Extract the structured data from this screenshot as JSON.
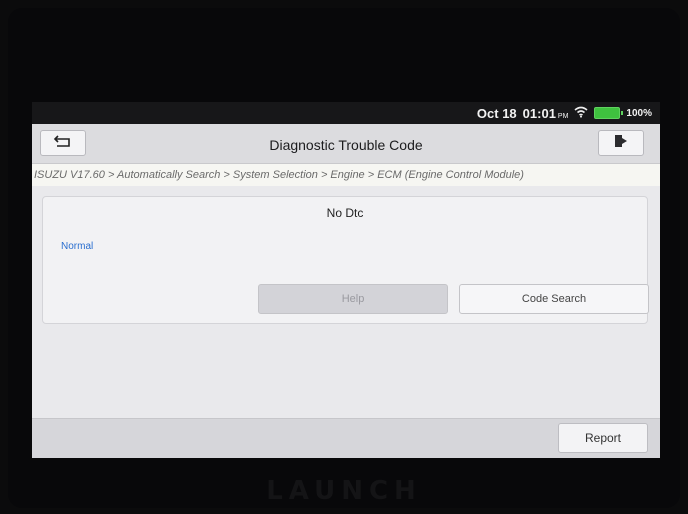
{
  "status_bar": {
    "date": "Oct 18",
    "time": "01:01",
    "ampm": "PM",
    "battery_percent": "100%",
    "battery_color": "#3fc23f",
    "icons": [
      "wifi-icon",
      "battery-icon"
    ]
  },
  "header": {
    "title": "Diagnostic Trouble Code",
    "back_icon": "back-arrow-icon",
    "exit_icon": "exit-icon"
  },
  "breadcrumb": "ISUZU V17.60 > Automatically Search > System Selection > Engine > ECM (Engine Control Module)",
  "dtc": {
    "title": "No Dtc",
    "status": "Normal",
    "status_color": "#2b6fcf",
    "help_label": "Help",
    "code_search_label": "Code Search"
  },
  "footer": {
    "report_label": "Report"
  },
  "device": {
    "brand": "LAUNCH"
  }
}
